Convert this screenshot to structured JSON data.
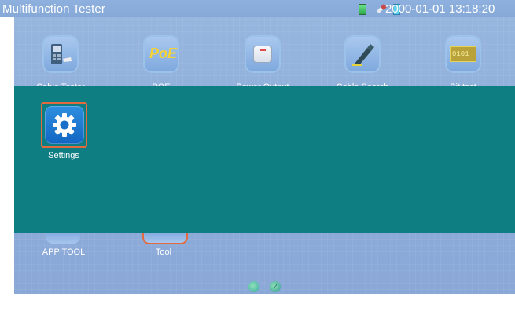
{
  "status_bar": {
    "app_title": "Multifunction Tester",
    "datetime": "2000-01-01 13:18:20",
    "icons": [
      "battery-icon",
      "link-icon",
      "charge-icon"
    ]
  },
  "top_row_apps": [
    {
      "label": "Cable Tester",
      "icon": "cable-tester-icon"
    },
    {
      "label": "POE",
      "icon": "poe-icon",
      "badge": "PoE"
    },
    {
      "label": "Power Output",
      "icon": "power-output-icon"
    },
    {
      "label": "Cable Search",
      "icon": "cable-search-icon"
    },
    {
      "label": "Bit test",
      "icon": "bit-test-icon",
      "badge": "0101"
    }
  ],
  "folder_overlay": {
    "items": [
      {
        "label": "Settings",
        "icon": "gear-icon",
        "selected": true
      }
    ]
  },
  "bottom_row_apps": [
    {
      "label": "APP TOOL",
      "icon": "app-tool-icon"
    },
    {
      "label": "Tool",
      "icon": "tool-icon"
    }
  ],
  "pagination": {
    "current_page": "2",
    "pages": 2
  },
  "colors": {
    "overlay": "#0e7e83",
    "selection_border": "#e36a3c",
    "settings_tile": "#1266c2",
    "background": "#8eaedb"
  }
}
